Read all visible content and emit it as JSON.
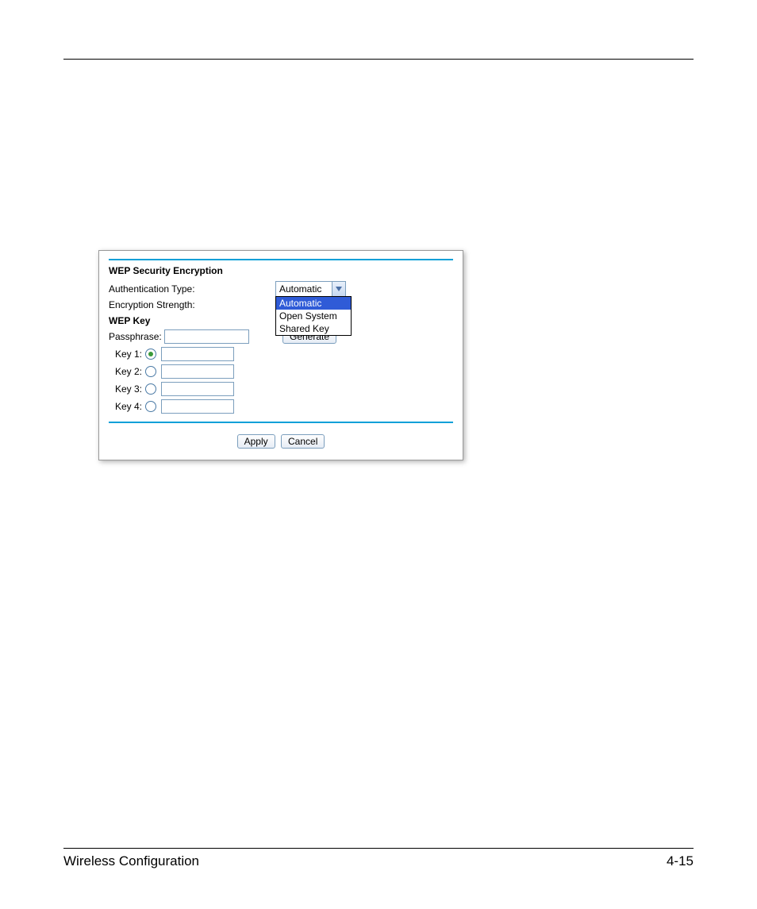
{
  "panel": {
    "section_title": "WEP Security Encryption",
    "auth_label": "Authentication Type:",
    "enc_label": "Encryption Strength:",
    "auth_select": {
      "value": "Automatic",
      "options": [
        "Automatic",
        "Open System",
        "Shared Key"
      ]
    },
    "wep_key_label": "WEP Key",
    "passphrase_label": "Passphrase:",
    "generate_btn": "Generate",
    "keys": [
      {
        "label": "Key 1:",
        "selected": true
      },
      {
        "label": "Key 2:",
        "selected": false
      },
      {
        "label": "Key 3:",
        "selected": false
      },
      {
        "label": "Key 4:",
        "selected": false
      }
    ],
    "apply_btn": "Apply",
    "cancel_btn": "Cancel"
  },
  "footer": {
    "left": "Wireless Configuration",
    "right": "4-15"
  }
}
